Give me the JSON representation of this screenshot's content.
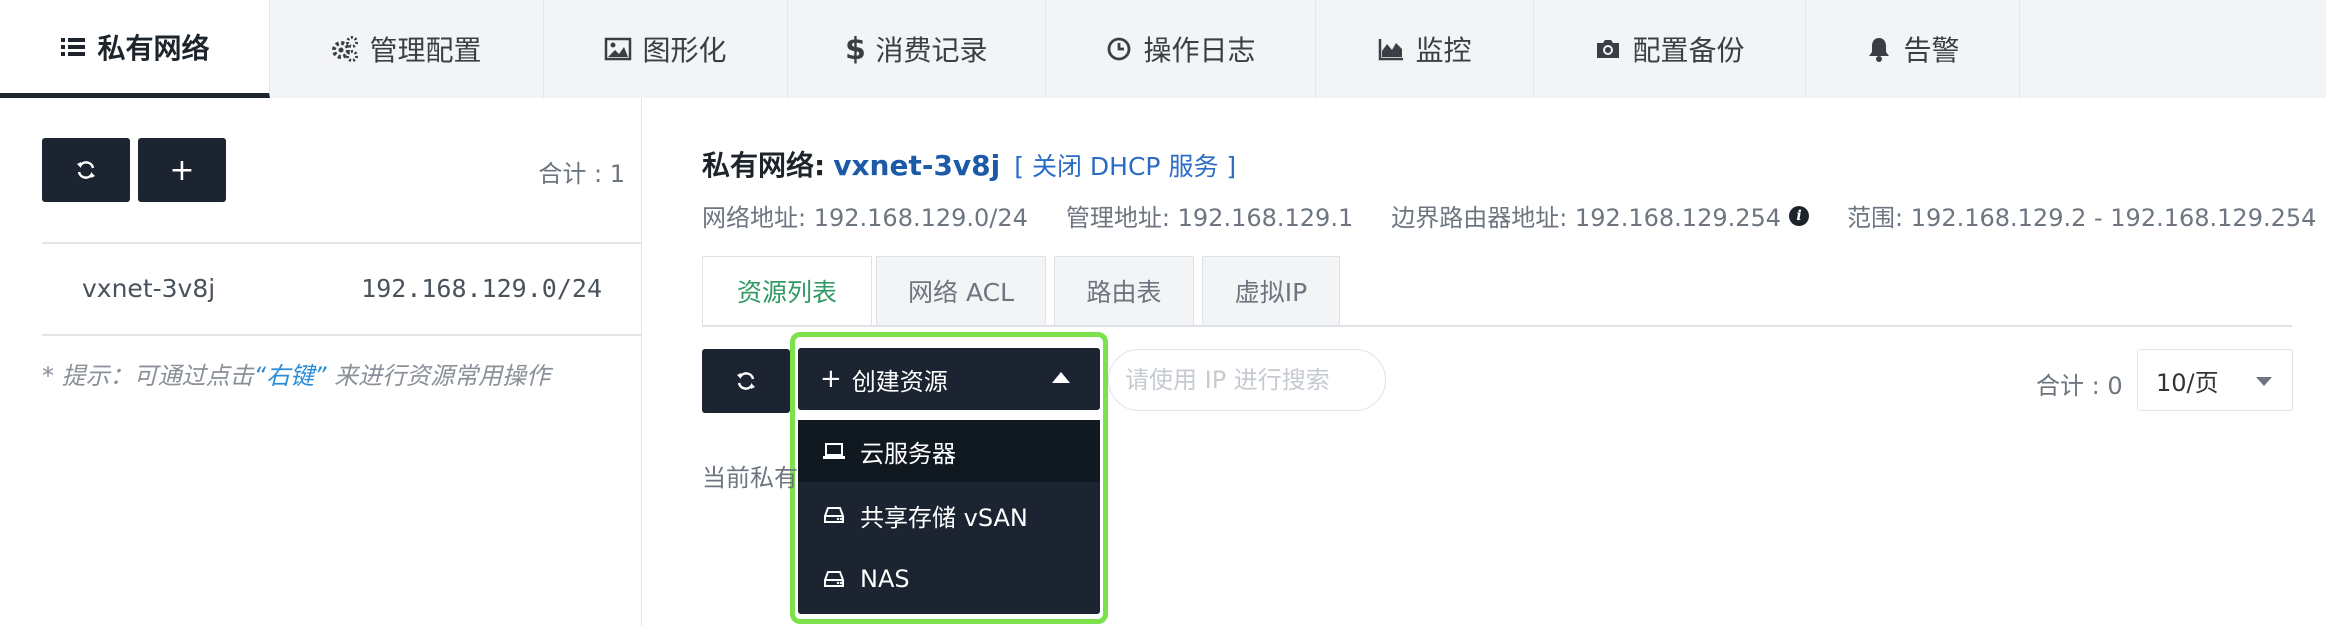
{
  "tabs": [
    {
      "label": "私有网络",
      "icon": "list-icon"
    },
    {
      "label": "管理配置",
      "icon": "gears-icon"
    },
    {
      "label": "图形化",
      "icon": "image-icon"
    },
    {
      "label": "消费记录",
      "icon": "dollar-icon"
    },
    {
      "label": "操作日志",
      "icon": "clock-icon"
    },
    {
      "label": "监控",
      "icon": "area-chart-icon"
    },
    {
      "label": "配置备份",
      "icon": "camera-icon"
    },
    {
      "label": "告警",
      "icon": "bell-icon"
    }
  ],
  "left_panel": {
    "refresh_icon": "refresh-icon",
    "add_label": "+",
    "total": "合计 : 1",
    "network": {
      "name": "vxnet-3v8j",
      "cidr": "192.168.129.0/24"
    },
    "tip_prefix": "* 提示：可通过点击",
    "tip_highlight": "“右键”",
    "tip_suffix": "来进行资源常用操作"
  },
  "detail": {
    "title_label": "私有网络:",
    "title_value": "vxnet-3v8j",
    "dhcp_link": "[ 关闭 DHCP 服务 ]",
    "network_address": "网络地址: 192.168.129.0/24",
    "manage_address": "管理地址: 192.168.129.1",
    "border_router_address": "边界路由器地址: 192.168.129.254",
    "range": "范围: 192.168.129.2 - 192.168.129.254"
  },
  "subtabs": [
    "资源列表",
    "网络 ACL",
    "路由表",
    "虚拟IP"
  ],
  "toolbar": {
    "create_label": "创建资源",
    "search_placeholder": "请使用 IP 进行搜索",
    "total": "合计 : 0",
    "page_size": "10/页"
  },
  "create_menu": [
    {
      "label": "云服务器",
      "icon": "laptop-icon"
    },
    {
      "label": "共享存储 vSAN",
      "icon": "hdd-icon"
    },
    {
      "label": "NAS",
      "icon": "hdd-icon"
    }
  ],
  "current_text": "当前私有",
  "colors": {
    "dark": "#1b2430",
    "accent_green": "#2f9a61",
    "link_blue": "#2b6cc4",
    "highlight": "#7ce14b"
  }
}
